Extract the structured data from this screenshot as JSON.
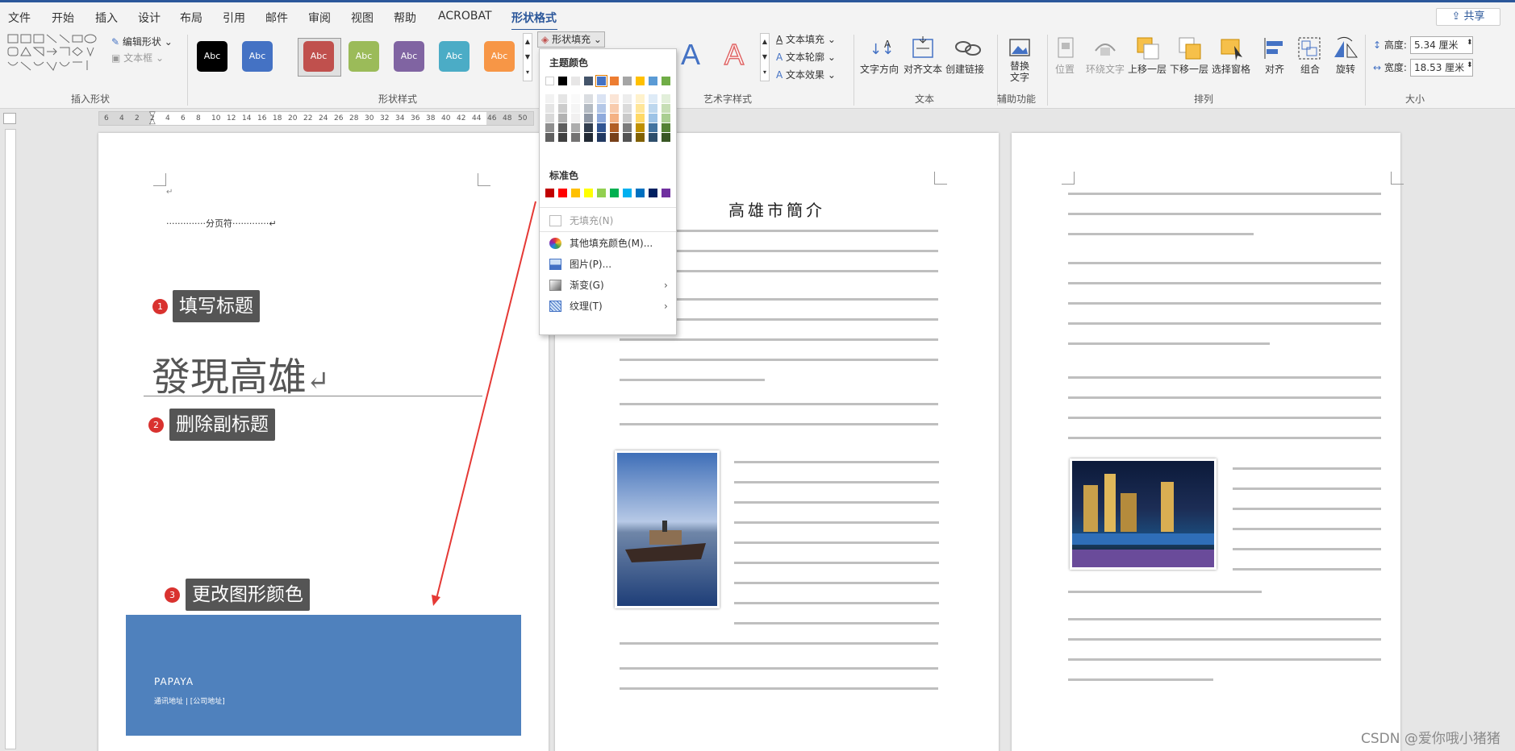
{
  "menu": {
    "items": [
      "文件",
      "开始",
      "插入",
      "设计",
      "布局",
      "引用",
      "邮件",
      "审阅",
      "视图",
      "帮助",
      "ACROBAT",
      "形状格式"
    ],
    "share_label": "共享"
  },
  "ribbon": {
    "insert_shape": {
      "edit_shape": "编辑形状",
      "text_box": "文本框",
      "group_label": "插入形状"
    },
    "shape_styles": {
      "swatch_text": "Abc",
      "swatches": [
        {
          "color": "#000000"
        },
        {
          "color": "#4472c4"
        },
        {
          "color": "#c0504d"
        },
        {
          "color": "#9bbb59"
        },
        {
          "color": "#8064a2"
        },
        {
          "color": "#4bacc6"
        },
        {
          "color": "#f79646"
        }
      ],
      "shape_fill": "形状填充",
      "group_label": "形状样式"
    },
    "art_text": {
      "text_fill": "文本填充",
      "text_outline": "文本轮廓",
      "text_effect": "文本效果",
      "group_label": "艺术字样式",
      "sample_blue": "A",
      "sample_red": "A"
    },
    "text_group": {
      "direction": "文字方向",
      "align": "对齐文本",
      "link": "创建链接",
      "group_label": "文本"
    },
    "aux": {
      "alt": "替换\n文字",
      "group_label": "辅助功能"
    },
    "arrange": {
      "position": "位置",
      "wrap": "环绕文字",
      "forward": "上移一层",
      "backward": "下移一层",
      "pane": "选择窗格",
      "align": "对齐",
      "group": "组合",
      "rotate": "旋转",
      "group_label": "排列"
    },
    "size": {
      "height_label": "高度:",
      "height_value": "5.34 厘米",
      "width_label": "宽度:",
      "width_value": "18.53 厘米",
      "group_label": "大小"
    }
  },
  "ruler": {
    "ticks": [
      "6",
      "4",
      "2",
      "2",
      "4",
      "6",
      "8",
      "10",
      "12",
      "14",
      "16",
      "18",
      "20",
      "22",
      "24",
      "26",
      "28",
      "30",
      "32",
      "34",
      "36",
      "38",
      "40",
      "42",
      "44",
      "46",
      "48",
      "50"
    ]
  },
  "page1": {
    "page_break": "分页符",
    "steps": [
      {
        "num": "1",
        "label": "填写标题"
      },
      {
        "num": "2",
        "label": "删除副标题"
      },
      {
        "num": "3",
        "label": "更改图形颜色"
      }
    ],
    "title": "發現高雄",
    "cover_company": "PAPAYA",
    "cover_address": "通讯地址 | [公司地址]"
  },
  "page2": {
    "title": "高雄市簡介"
  },
  "dropdown": {
    "theme_colors_label": "主题颜色",
    "standard_colors_label": "标准色",
    "theme_top": [
      "#ffffff",
      "#000000",
      "#e7e6e6",
      "#44546a",
      "#4472c4",
      "#ed7d31",
      "#a5a5a5",
      "#ffc000",
      "#5b9bd5",
      "#70ad47"
    ],
    "standard": [
      "#c00000",
      "#ff0000",
      "#ffc000",
      "#ffff00",
      "#92d050",
      "#00b050",
      "#00b0f0",
      "#0070c0",
      "#002060",
      "#7030a0"
    ],
    "no_fill": "无填充(N)",
    "more_colors": "其他填充颜色(M)...",
    "picture": "图片(P)...",
    "gradient": "渐变(G)",
    "texture": "纹理(T)"
  },
  "watermark": "CSDN @爱你哦小猪猪"
}
